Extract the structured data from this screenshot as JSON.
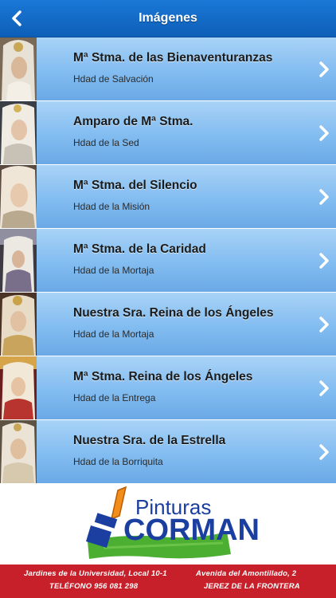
{
  "header": {
    "title": "Imágenes",
    "back_icon": "chevron-left-icon"
  },
  "items": [
    {
      "title": "Mª Stma. de las Bienaventuranzas",
      "subtitle": "Hdad de Salvación"
    },
    {
      "title": "Amparo de Mª Stma.",
      "subtitle": "Hdad de la Sed"
    },
    {
      "title": "Mª Stma. del Silencio",
      "subtitle": "Hdad de la Misión"
    },
    {
      "title": "Mª Stma. de la Caridad",
      "subtitle": "Hdad de la Mortaja"
    },
    {
      "title": "Nuestra Sra. Reina de los Ángeles",
      "subtitle": "Hdad de la Mortaja"
    },
    {
      "title": "Mª Stma. Reina de los Ángeles",
      "subtitle": "Hdad de la Entrega"
    },
    {
      "title": "Nuestra Sra. de la Estrella",
      "subtitle": "Hdad de la Borriquita"
    }
  ],
  "ad": {
    "brand_top": "Pinturas",
    "brand_main": "CORMAN",
    "address_left": "Jardines de la Universidad, Local 10-1",
    "address_right": "Avenida del Amontillado, 2",
    "phone": "TELÉFONO 956 081 298",
    "city": "JEREZ DE LA FRONTERA"
  },
  "colors": {
    "header": "#0d5fb8",
    "row": "#82bcf0",
    "footer": "#c8202a",
    "brand": "#1a3fa0",
    "brush_green": "#4caf32"
  }
}
